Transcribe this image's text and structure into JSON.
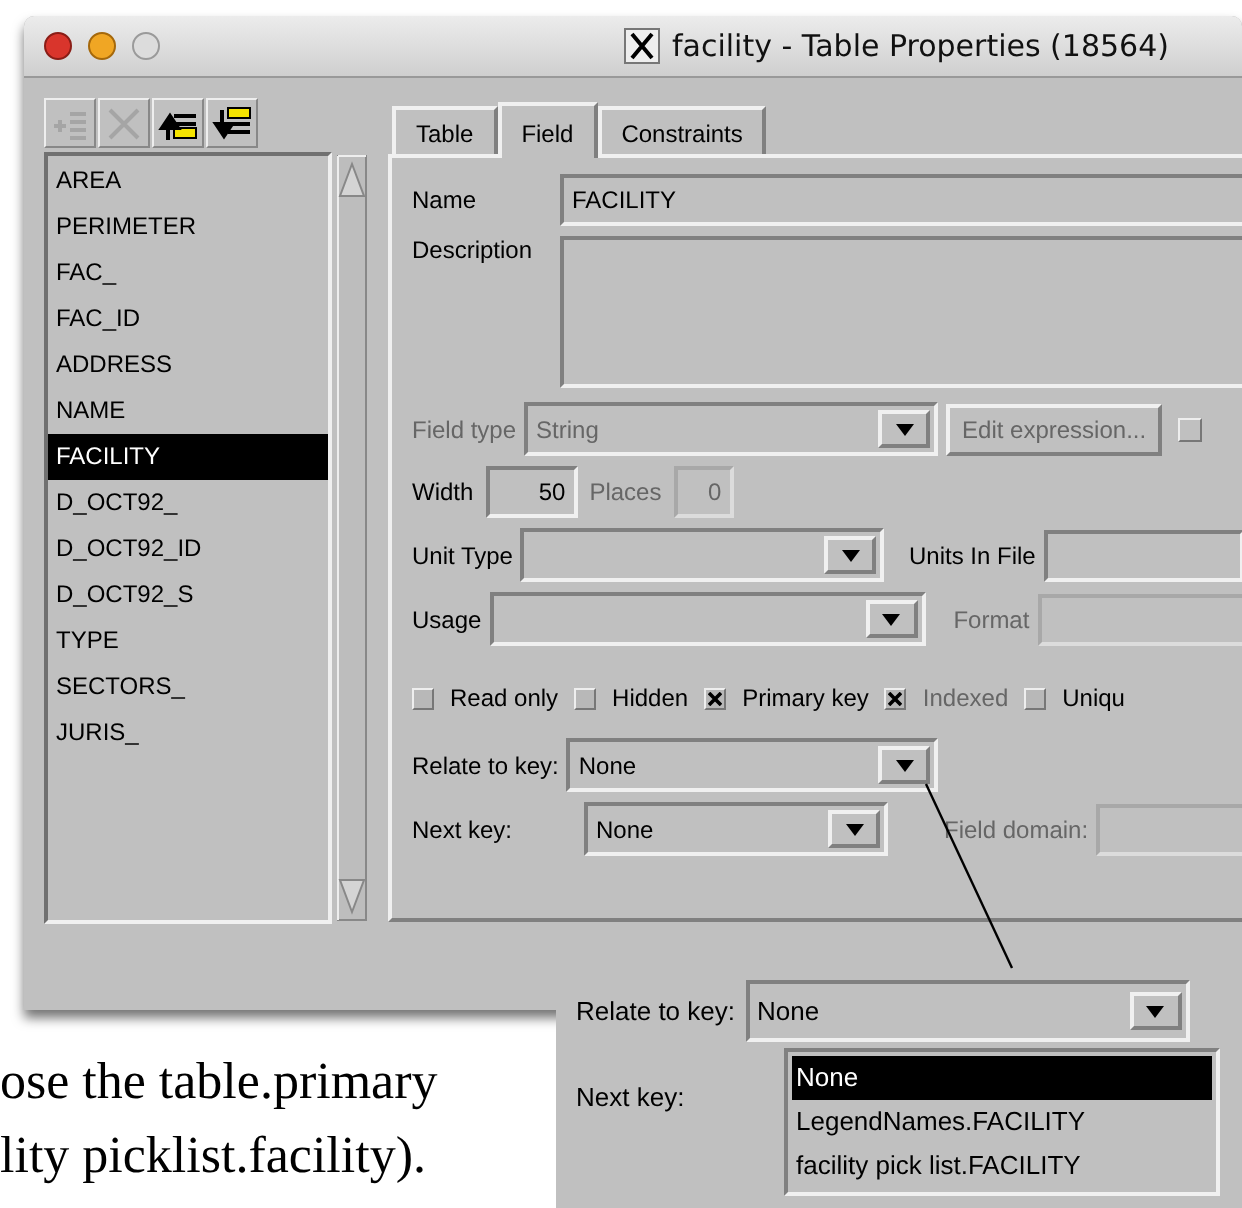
{
  "window": {
    "title": "facility - Table Properties (18564)"
  },
  "toolbar": [
    {
      "kind": "add",
      "disabled": true
    },
    {
      "kind": "delete",
      "disabled": true
    },
    {
      "kind": "move-up",
      "disabled": false
    },
    {
      "kind": "move-down",
      "disabled": false
    }
  ],
  "fields": [
    {
      "label": "AREA",
      "selected": false
    },
    {
      "label": "PERIMETER",
      "selected": false
    },
    {
      "label": "FAC_",
      "selected": false
    },
    {
      "label": "FAC_ID",
      "selected": false
    },
    {
      "label": "ADDRESS",
      "selected": false
    },
    {
      "label": "NAME",
      "selected": false
    },
    {
      "label": "FACILITY",
      "selected": true
    },
    {
      "label": "D_OCT92_",
      "selected": false
    },
    {
      "label": "D_OCT92_ID",
      "selected": false
    },
    {
      "label": "D_OCT92_S",
      "selected": false
    },
    {
      "label": "TYPE",
      "selected": false
    },
    {
      "label": "SECTORS_",
      "selected": false
    },
    {
      "label": "JURIS_",
      "selected": false
    }
  ],
  "tabs": [
    {
      "label": "Table",
      "selected": false
    },
    {
      "label": "Field",
      "selected": true
    },
    {
      "label": "Constraints",
      "selected": false
    }
  ],
  "form": {
    "name": {
      "label": "Name",
      "value": "FACILITY",
      "disabled": false
    },
    "description": {
      "label": "Description",
      "disabled": false
    },
    "field_type": {
      "label": "Field type",
      "value": "String",
      "disabled": true
    },
    "edit_expression": {
      "label": "Edit expression...",
      "disabled": true
    },
    "side_checkbox": {
      "checked": false
    },
    "width": {
      "label": "Width",
      "value": "50",
      "disabled": false
    },
    "places": {
      "label": "Places",
      "value": "0",
      "disabled": true
    },
    "unit_type": {
      "label": "Unit Type",
      "disabled": false
    },
    "units_in_file": {
      "label": "Units In File",
      "disabled": false
    },
    "usage": {
      "label": "Usage",
      "disabled": false
    },
    "format": {
      "label": "Format",
      "disabled": true
    },
    "options": [
      {
        "label": "Read only",
        "checked": false,
        "disabled": false
      },
      {
        "label": "Hidden",
        "checked": false,
        "disabled": false
      },
      {
        "label": "Primary key",
        "checked": true,
        "disabled": false
      },
      {
        "label": "Indexed",
        "checked": true,
        "disabled": true
      },
      {
        "label": "Uniqu",
        "checked": false,
        "disabled": false
      }
    ],
    "relate_to_key": {
      "label": "Relate to key:",
      "value": "None",
      "disabled": false
    },
    "next_key": {
      "label": "Next key:",
      "value": "None",
      "disabled": false
    },
    "field_domain": {
      "label": "Field domain:",
      "disabled": true
    }
  },
  "callout": {
    "relate_to_key": {
      "label": "Relate to key:",
      "value": "None"
    },
    "next_key": {
      "label": "Next key:"
    },
    "options": [
      {
        "label": "None",
        "selected": true
      },
      {
        "label": "LegendNames.FACILITY",
        "selected": false
      },
      {
        "label": "facility pick list.FACILITY",
        "selected": false
      }
    ]
  },
  "caption": {
    "lines": [
      "ose the table.primary",
      "lity picklist.facility)."
    ]
  }
}
